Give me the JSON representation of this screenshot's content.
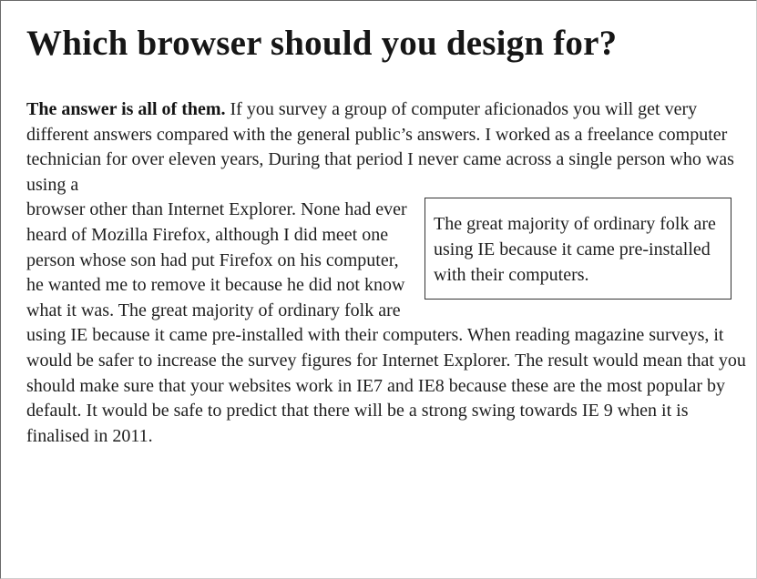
{
  "article": {
    "heading": "Which browser should you design for?",
    "lead": "The answer is all of them.",
    "intro": " If you survey a group of computer aficionados you will get very different answers compared with the general public’s answers.  I worked as a freelance computer technician for over eleven years, During that period I never came across a single person who was using a ",
    "continuation": "browser other than Internet Explorer. None had ever heard of Mozilla Firefox, although I did meet one person whose son had put Firefox on his computer, he wanted me to remove it because he did not know what it was. The great majority of ordinary folk are using IE because it came pre-installed with their computers. When reading magazine surveys, it would be safer to increase the survey figures for Internet Explorer. The result would mean that you should make sure that your websites work in IE7 and IE8 because these are the most popular by default. It would be safe to predict that there will be a strong swing towards IE 9 when it is finalised in 2011.",
    "pullquote": "The great majority of ordinary folk are using IE because it came pre-installed with their computers."
  }
}
